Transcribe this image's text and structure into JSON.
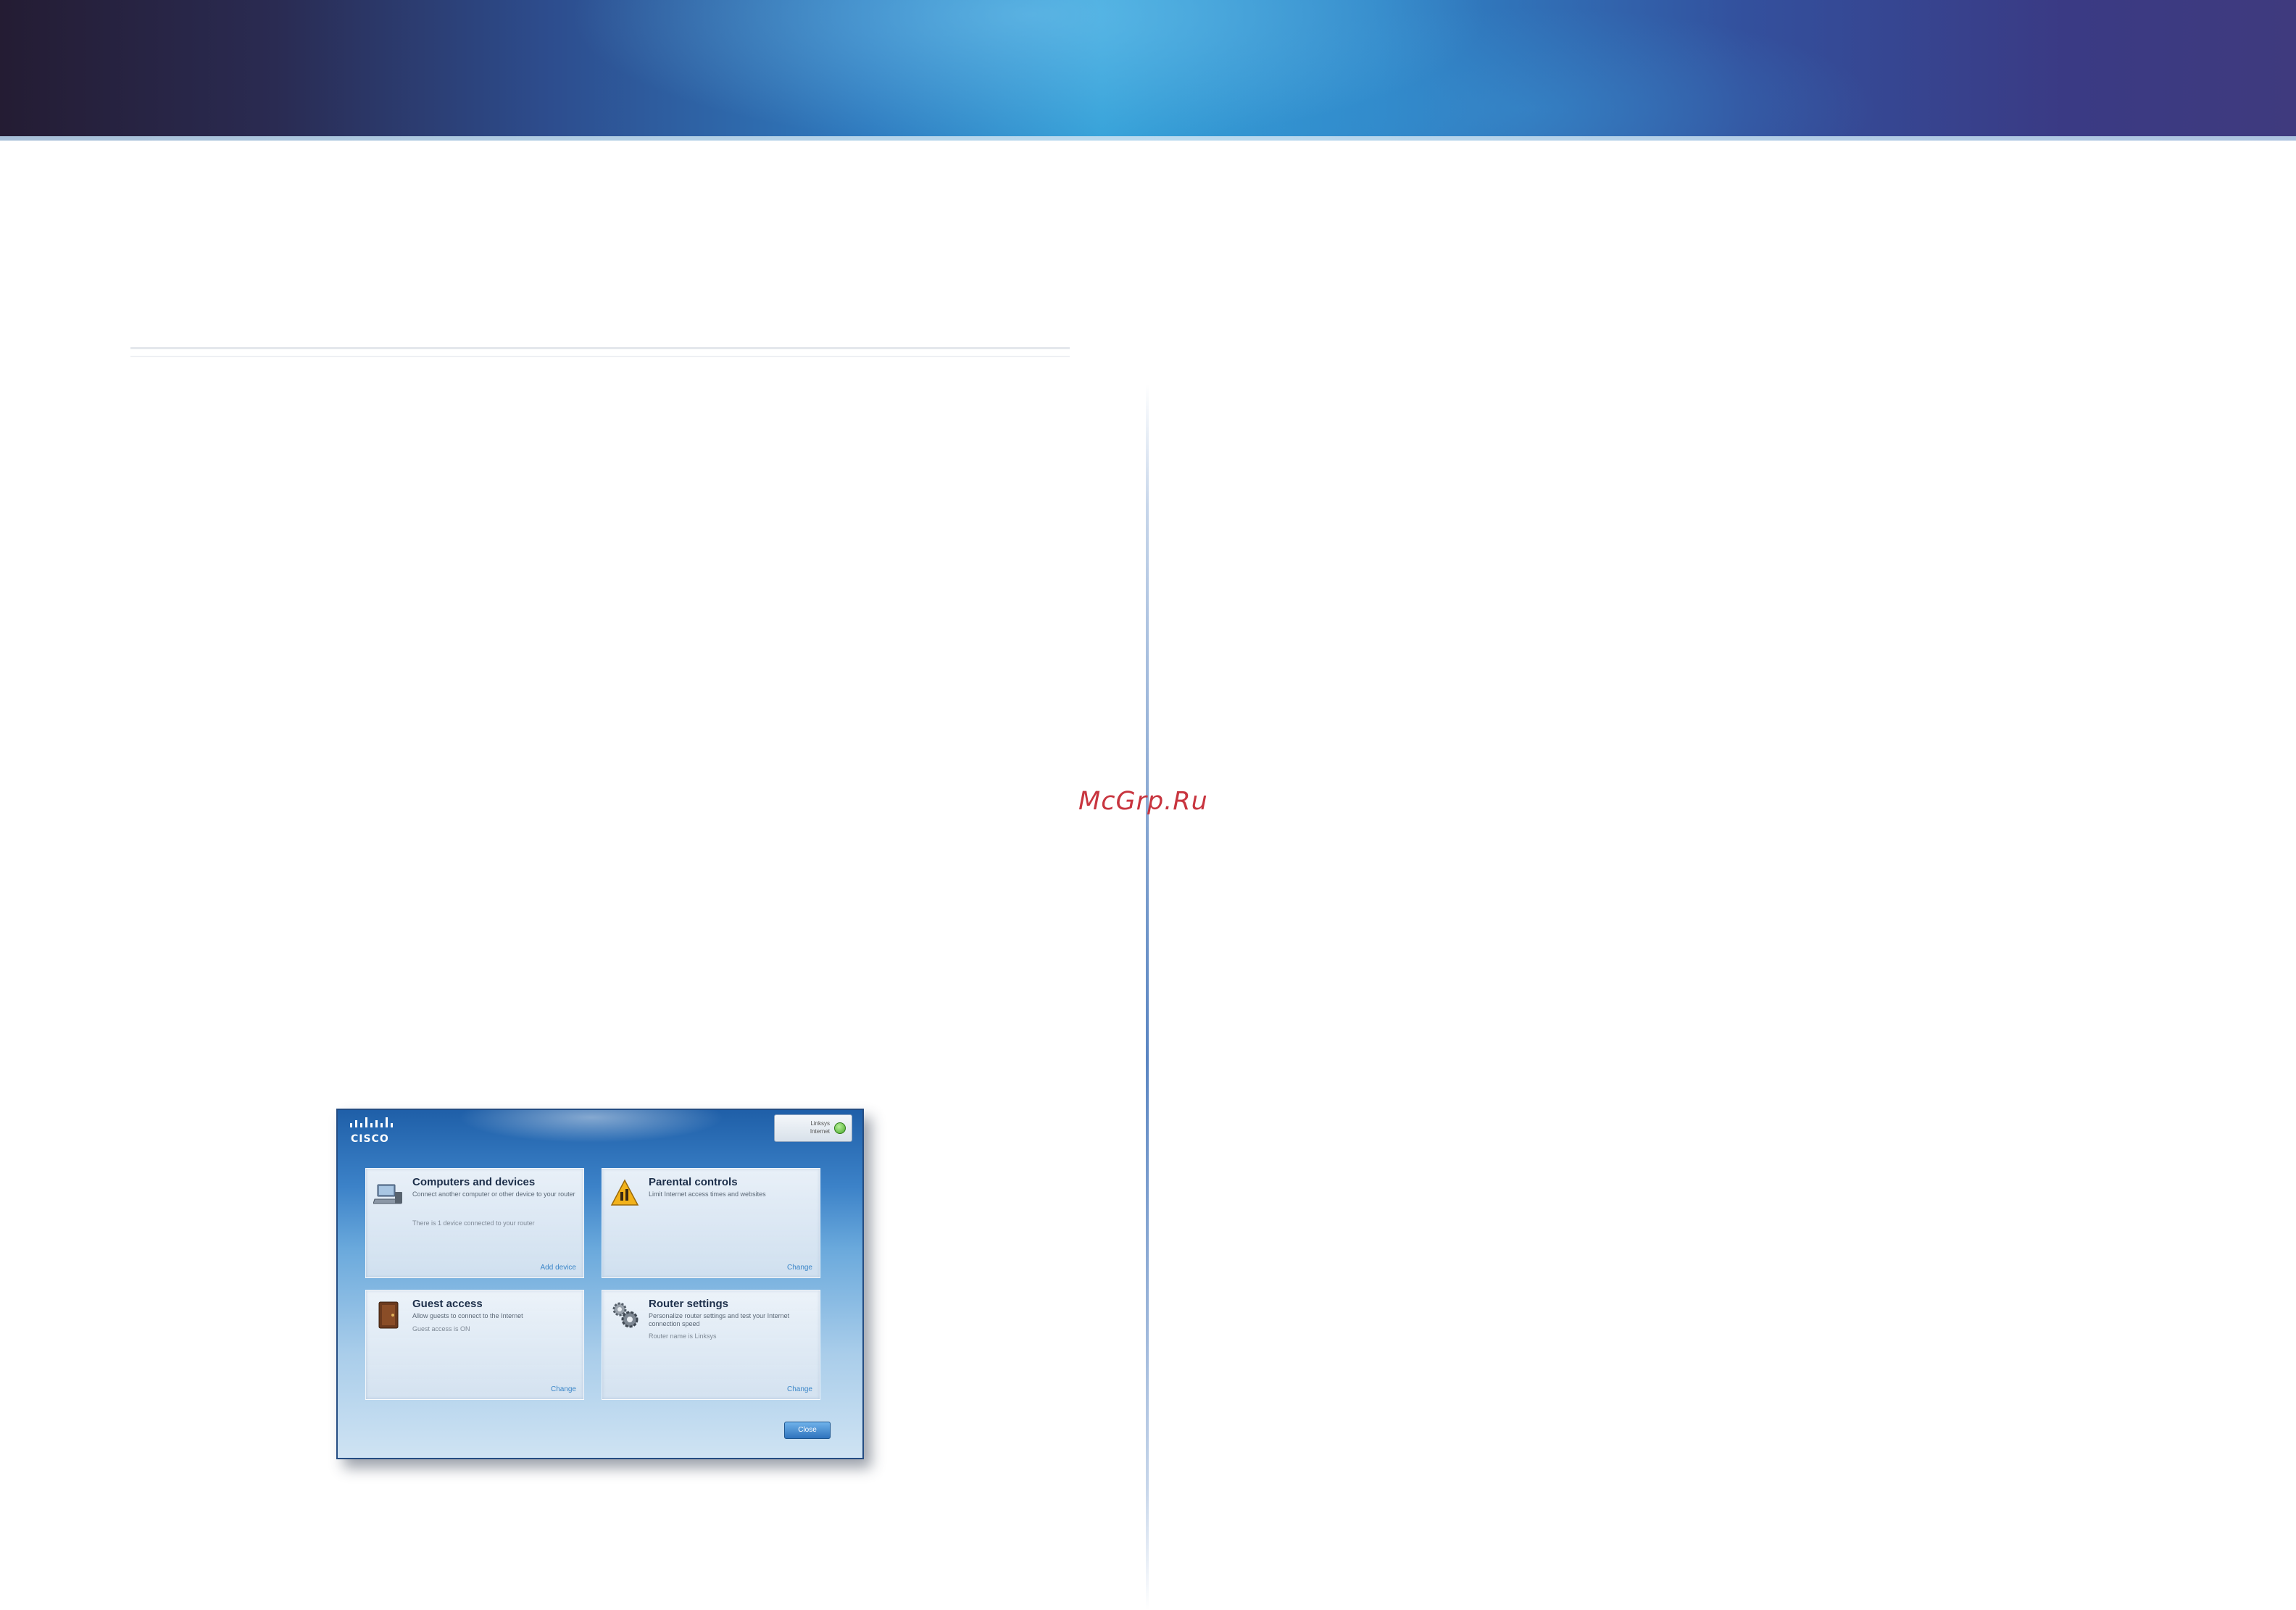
{
  "watermark": "McGrp.Ru",
  "screenshot": {
    "brand": "CISCO",
    "status": {
      "line1": "Linksys",
      "line2": "Internet",
      "icon": "green-status-dot",
      "color": "#48a92a"
    },
    "panels": [
      {
        "title": "Computers and devices",
        "description": "Connect another computer or other device to your router",
        "status": "There is 1 device connected to your router",
        "link": "Add device",
        "icon": "computer-devices-icon"
      },
      {
        "title": "Parental controls",
        "description": "Limit Internet access times and websites",
        "status": "",
        "link": "Change",
        "icon": "warning-sign-icon"
      },
      {
        "title": "Guest access",
        "description": "Allow guests to connect to the Internet",
        "status": "Guest access is ON",
        "link": "Change",
        "icon": "guest-door-icon"
      },
      {
        "title": "Router settings",
        "description": "Personalize router settings and test your Internet connection speed",
        "status": "Router name is Linksys",
        "link": "Change",
        "icon": "gears-icon"
      }
    ],
    "close_label": "Close"
  },
  "colors": {
    "banner_blue": "#36a2d9",
    "banner_dark": "#241c33",
    "watermark_red": "#c8353f",
    "link_blue": "#3b86c8"
  }
}
